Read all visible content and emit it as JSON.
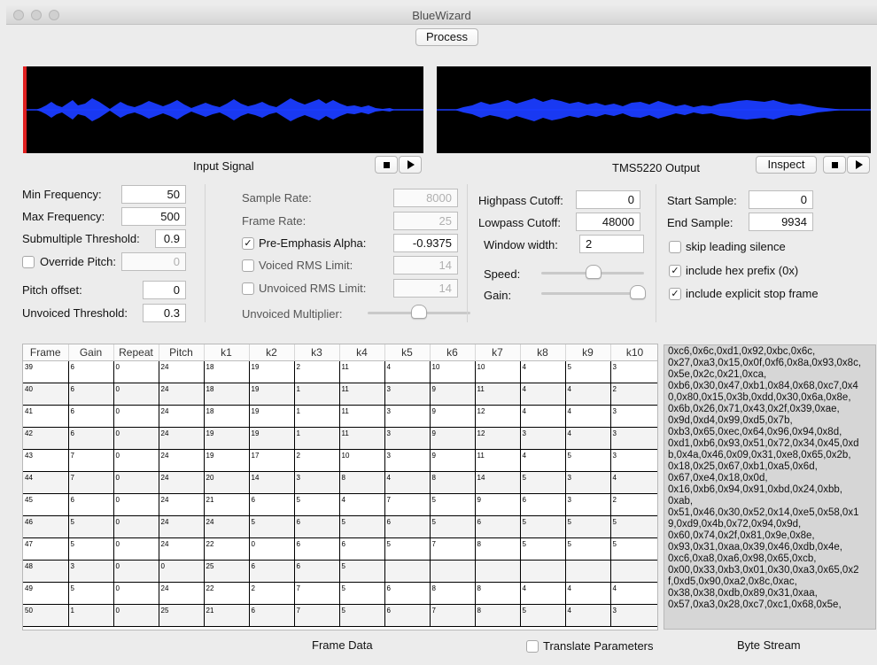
{
  "window": {
    "title": "BlueWizard"
  },
  "toolbar": {
    "process_label": "Process"
  },
  "input_panel": {
    "caption": "Input Signal"
  },
  "output_panel": {
    "caption": "TMS5220 Output",
    "inspect_label": "Inspect"
  },
  "colors": {
    "waveform": "#1a3cff",
    "cursor": "#e02020",
    "wave_bg": "#000000"
  },
  "pitch_settings": {
    "min_frequency": {
      "label": "Min Frequency:",
      "value": "50"
    },
    "max_frequency": {
      "label": "Max Frequency:",
      "value": "500"
    },
    "submultiple_threshold": {
      "label": "Submultiple Threshold:",
      "value": "0.9"
    },
    "override_pitch": {
      "label": "Override Pitch:",
      "value": "0",
      "checked": false
    },
    "pitch_offset": {
      "label": "Pitch offset:",
      "value": "0"
    },
    "unvoiced_threshold": {
      "label": "Unvoiced Threshold:",
      "value": "0.3"
    }
  },
  "signal_settings": {
    "sample_rate": {
      "label": "Sample Rate:",
      "value": "8000"
    },
    "frame_rate": {
      "label": "Frame Rate:",
      "value": "25"
    },
    "pre_emphasis": {
      "label": "Pre-Emphasis Alpha:",
      "value": "-0.9375",
      "checked": true
    },
    "voiced_rms": {
      "label": "Voiced RMS Limit:",
      "value": "14",
      "checked": false
    },
    "unvoiced_rms": {
      "label": "Unvoiced RMS Limit:",
      "value": "14",
      "checked": false
    },
    "unvoiced_multiplier": {
      "label": "Unvoiced Multiplier:",
      "level": 0.5
    }
  },
  "filter_settings": {
    "highpass": {
      "label": "Highpass Cutoff:",
      "value": "0"
    },
    "lowpass": {
      "label": "Lowpass Cutoff:",
      "value": "48000"
    },
    "window_width": {
      "label": "Window width:",
      "value": "2"
    },
    "speed": {
      "label": "Speed:",
      "level": 0.5
    },
    "gain": {
      "label": "Gain:",
      "level": 1.0
    }
  },
  "output_settings": {
    "start_sample": {
      "label": "Start Sample:",
      "value": "0"
    },
    "end_sample": {
      "label": "End Sample:",
      "value": "9934"
    },
    "skip_silence": {
      "label": "skip leading silence",
      "checked": false
    },
    "hex_prefix": {
      "label": "include hex prefix (0x)",
      "checked": true
    },
    "stop_frame": {
      "label": "include explicit stop frame",
      "checked": true
    }
  },
  "frame_table": {
    "columns": [
      "Frame",
      "Gain",
      "Repeat",
      "Pitch",
      "k1",
      "k2",
      "k3",
      "k4",
      "k5",
      "k6",
      "k7",
      "k8",
      "k9",
      "k10"
    ],
    "rows": [
      [
        "39",
        "6",
        "0",
        "24",
        "18",
        "19",
        "2",
        "11",
        "4",
        "10",
        "10",
        "4",
        "5",
        "3"
      ],
      [
        "40",
        "6",
        "0",
        "24",
        "18",
        "19",
        "1",
        "11",
        "3",
        "9",
        "11",
        "4",
        "4",
        "2"
      ],
      [
        "41",
        "6",
        "0",
        "24",
        "18",
        "19",
        "1",
        "11",
        "3",
        "9",
        "12",
        "4",
        "4",
        "3"
      ],
      [
        "42",
        "6",
        "0",
        "24",
        "19",
        "19",
        "1",
        "11",
        "3",
        "9",
        "12",
        "3",
        "4",
        "3"
      ],
      [
        "43",
        "7",
        "0",
        "24",
        "19",
        "17",
        "2",
        "10",
        "3",
        "9",
        "11",
        "4",
        "5",
        "3"
      ],
      [
        "44",
        "7",
        "0",
        "24",
        "20",
        "14",
        "3",
        "8",
        "4",
        "8",
        "14",
        "5",
        "3",
        "4"
      ],
      [
        "45",
        "6",
        "0",
        "24",
        "21",
        "6",
        "5",
        "4",
        "7",
        "5",
        "9",
        "6",
        "3",
        "2"
      ],
      [
        "46",
        "5",
        "0",
        "24",
        "24",
        "5",
        "6",
        "5",
        "6",
        "5",
        "6",
        "5",
        "5",
        "5"
      ],
      [
        "47",
        "5",
        "0",
        "24",
        "22",
        "0",
        "6",
        "6",
        "5",
        "7",
        "8",
        "5",
        "5",
        "5"
      ],
      [
        "48",
        "3",
        "0",
        "0",
        "25",
        "6",
        "6",
        "5",
        "",
        "",
        "",
        "",
        "",
        ""
      ],
      [
        "49",
        "5",
        "0",
        "24",
        "22",
        "2",
        "7",
        "5",
        "6",
        "8",
        "8",
        "4",
        "4",
        "4"
      ],
      [
        "50",
        "1",
        "0",
        "25",
        "21",
        "6",
        "7",
        "5",
        "6",
        "7",
        "8",
        "5",
        "4",
        "3"
      ]
    ]
  },
  "bottom_bar": {
    "frame_data_label": "Frame Data",
    "translate_label": "Translate Parameters",
    "translate_checked": false,
    "byte_stream_label": "Byte Stream"
  },
  "byte_stream": {
    "lines": [
      "0xc6,0x6c,0xd1,0x92,0xbc,0x6c,",
      "0x27,0xa3,0x15,0x0f,0xf6,0x8a,0x93,0x8c,",
      "0x5e,0x2c,0x21,0xca,",
      "0xb6,0x30,0x47,0xb1,0x84,0x68,0xc7,0x4",
      "0,0x80,0x15,0x3b,0xdd,0x30,0x6a,0x8e,",
      "0x6b,0x26,0x71,0x43,0x2f,0x39,0xae,",
      "0x9d,0xd4,0x99,0xd5,0x7b,",
      "0xb3,0x65,0xec,0x64,0x96,0x94,0x8d,",
      "0xd1,0xb6,0x93,0x51,0x72,0x34,0x45,0xd",
      "b,0x4a,0x46,0x09,0x31,0xe8,0x65,0x2b,",
      "0x18,0x25,0x67,0xb1,0xa5,0x6d,",
      "0x67,0xe4,0x18,0x0d,",
      "0x16,0xb6,0x94,0x91,0xbd,0x24,0xbb,",
      "0xab,",
      "0x51,0x46,0x30,0x52,0x14,0xe5,0x58,0x1",
      "9,0xd9,0x4b,0x72,0x94,0x9d,",
      "0x60,0x74,0x2f,0x81,0x9e,0x8e,",
      "0x93,0x31,0xaa,0x39,0x46,0xdb,0x4e,",
      "0xc6,0xa8,0xa6,0x98,0x65,0xcb,",
      "0x00,0x33,0xb3,0x01,0x30,0xa3,0x65,0x2",
      "f,0xd5,0x90,0xa2,0x8c,0xac,",
      "0x38,0x38,0xdb,0x89,0x31,0xaa,",
      "0x57,0xa3,0x28,0xc7,0xc1,0x68,0x5e,"
    ]
  }
}
